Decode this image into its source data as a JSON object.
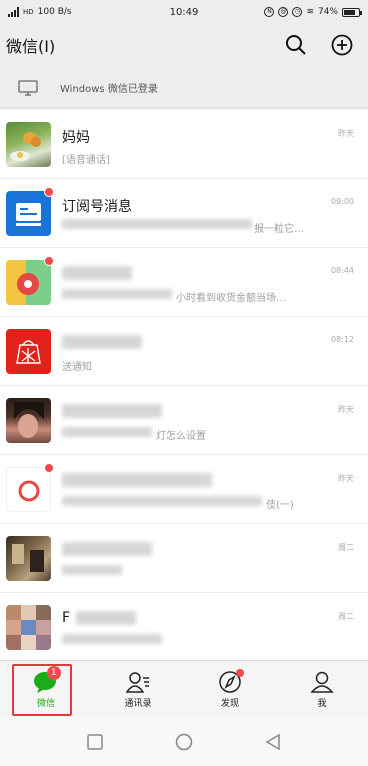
{
  "status": {
    "signal_text": "HD",
    "speed": "100 B/s",
    "time": "10:49",
    "battery": "74%"
  },
  "header": {
    "title": "微信(I)"
  },
  "windows_bar": {
    "text": "Windows 微信已登录"
  },
  "chats": [
    {
      "name": "妈妈",
      "preview": "[语音通话]",
      "time": "昨天",
      "avatar": "butterfly-photo",
      "dot": false
    },
    {
      "name": "订阅号消息",
      "preview": "报一粒它…",
      "time": "09:00",
      "avatar": "subscription-icon",
      "dot": true
    },
    {
      "name": "",
      "preview": "小时看到收货金额当场…",
      "time": "08:44",
      "avatar": "app-icon",
      "dot": true
    },
    {
      "name": "",
      "preview": "送通知",
      "time": "08:12",
      "avatar": "pinduoduo-icon",
      "dot": false
    },
    {
      "name": "",
      "preview": "灯怎么设置",
      "time": "昨天",
      "avatar": "person-photo",
      "dot": false
    },
    {
      "name": "",
      "preview": "伎(一)",
      "time": "昨天",
      "avatar": "service-icon",
      "dot": true
    },
    {
      "name": "",
      "preview": "",
      "time": "周二",
      "avatar": "room-photo",
      "dot": false
    },
    {
      "name": "F",
      "preview": "",
      "time": "周二",
      "avatar": "group-collage",
      "dot": false
    }
  ],
  "tabs": [
    {
      "label": "微信",
      "badge": "1",
      "active": true
    },
    {
      "label": "通讯录",
      "badge": "",
      "active": false
    },
    {
      "label": "发现",
      "badge": "",
      "active": false,
      "dot": true
    },
    {
      "label": "我",
      "badge": "",
      "active": false
    }
  ],
  "colors": {
    "accent": "#1aad19",
    "badge": "#f04a4a",
    "highlight_box": "#e53935"
  }
}
